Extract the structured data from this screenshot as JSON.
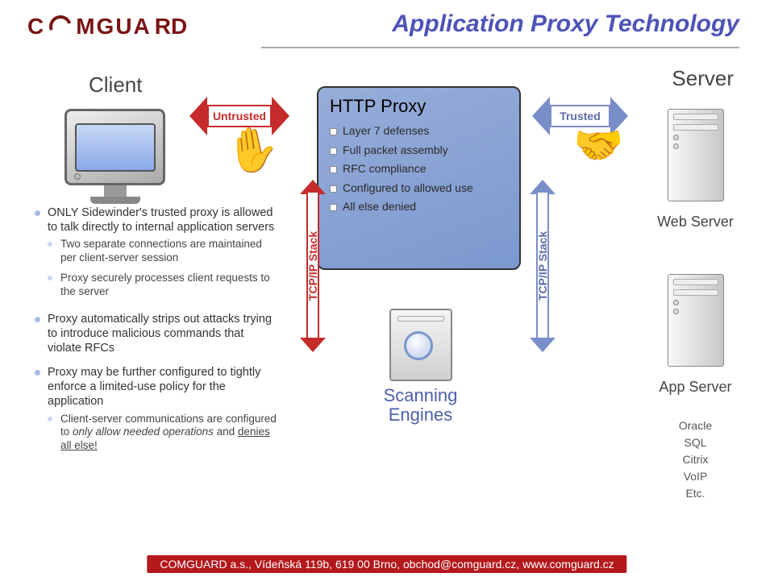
{
  "brand": "comGUARD",
  "title": "Application Proxy Technology",
  "labels": {
    "client": "Client",
    "server": "Server",
    "untrusted": "Untrusted",
    "trusted": "Trusted",
    "web_server": "Web Server",
    "app_server": "App Server",
    "tcpip": "TCP/IP Stack",
    "scanning": "Scanning Engines"
  },
  "app_server_items": [
    "Oracle",
    "SQL",
    "Citrix",
    "VoIP",
    "Etc."
  ],
  "proxy": {
    "heading": "HTTP Proxy",
    "items": [
      "Layer 7 defenses",
      "Full packet assembly",
      "RFC compliance",
      "Configured to allowed use",
      "All else denied"
    ]
  },
  "bullets": {
    "b1": "ONLY Sidewinder's trusted proxy is allowed to talk directly to internal application servers",
    "b1a": "Two separate connections are maintained per client-server session",
    "b1b": "Proxy securely processes client requests to the server",
    "b2": "Proxy automatically strips out attacks trying to introduce malicious commands that violate RFCs",
    "b3": "Proxy may be further configured to tightly enforce a limited-use policy for the application",
    "b3a_pre": "Client-server communications are configured to ",
    "b3a_em1": "only allow needed operations",
    "b3a_mid": " and ",
    "b3a_em2": "denies all else!"
  },
  "footer": "COMGUARD a.s., Vídeňská 119b, 619 00 Brno, obchod@comguard.cz, www.comguard.cz"
}
